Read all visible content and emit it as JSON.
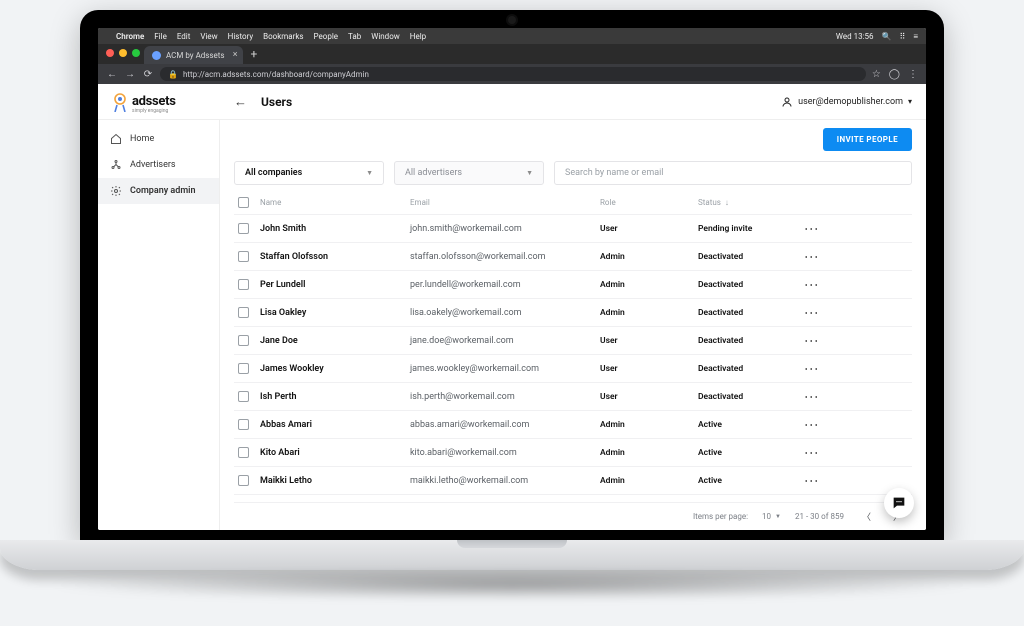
{
  "mac_menu": {
    "apple": "",
    "items": [
      "Chrome",
      "File",
      "Edit",
      "View",
      "History",
      "Bookmarks",
      "People",
      "Tab",
      "Window",
      "Help"
    ],
    "clock": "Wed 13:56"
  },
  "browser": {
    "tab_title": "ACM by Adssets",
    "url": "http://acm.adssets.com/dashboard/companyAdmin"
  },
  "brand": {
    "name": "adssets",
    "tagline": "simply engaging"
  },
  "page": {
    "back": "←",
    "title": "Users",
    "user": "user@demopublisher.com"
  },
  "sidebar": {
    "items": [
      {
        "label": "Home",
        "icon": "home-icon"
      },
      {
        "label": "Advertisers",
        "icon": "advertisers-icon"
      },
      {
        "label": "Company admin",
        "icon": "gear-icon"
      }
    ]
  },
  "actions": {
    "invite": "INVITE PEOPLE"
  },
  "filters": {
    "companies": "All companies",
    "advertisers": "All advertisers",
    "search_placeholder": "Search by name or email"
  },
  "table": {
    "headers": {
      "name": "Name",
      "email": "Email",
      "role": "Role",
      "status": "Status"
    },
    "rows": [
      {
        "name": "John Smith",
        "email": "john.smith@workemail.com",
        "role": "User",
        "status": "Pending invite"
      },
      {
        "name": "Staffan Olofsson",
        "email": "staffan.olofsson@workemail.com",
        "role": "Admin",
        "status": "Deactivated"
      },
      {
        "name": "Per Lundell",
        "email": "per.lundell@workemail.com",
        "role": "Admin",
        "status": "Deactivated"
      },
      {
        "name": "Lisa Oakley",
        "email": "lisa.oakely@workemail.com",
        "role": "Admin",
        "status": "Deactivated"
      },
      {
        "name": "Jane Doe",
        "email": "jane.doe@workemail.com",
        "role": "User",
        "status": "Deactivated"
      },
      {
        "name": "James Wookley",
        "email": "james.wookley@workemail.com",
        "role": "User",
        "status": "Deactivated"
      },
      {
        "name": "Ish Perth",
        "email": "ish.perth@workemail.com",
        "role": "User",
        "status": "Deactivated"
      },
      {
        "name": "Abbas Amari",
        "email": "abbas.amari@workemail.com",
        "role": "Admin",
        "status": "Active"
      },
      {
        "name": "Kito Abari",
        "email": "kito.abari@workemail.com",
        "role": "Admin",
        "status": "Active"
      },
      {
        "name": "Maikki Letho",
        "email": "maikki.letho@workemail.com",
        "role": "Admin",
        "status": "Active"
      }
    ]
  },
  "pagination": {
    "label": "Items per page:",
    "per_page": "10",
    "range": "21 - 30 of 859"
  }
}
